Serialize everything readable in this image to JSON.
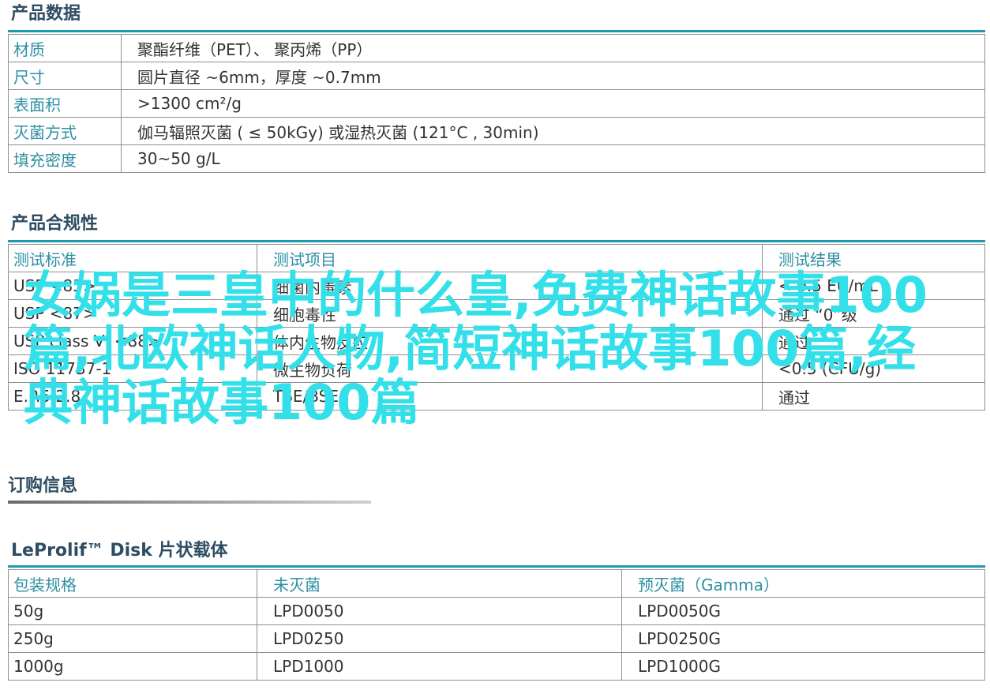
{
  "product_data": {
    "title": "产品数据",
    "rows": [
      {
        "key": "材质",
        "value": "聚酯纤维（PET）、 聚丙烯（PP）"
      },
      {
        "key": "尺寸",
        "value": "圆片直径 ~6mm，厚度 ~0.7mm"
      },
      {
        "key": "表面积",
        "value": ">1300 cm²/g"
      },
      {
        "key": "灭菌方式",
        "value": "伽马辐照灭菌 ( ≤ 50kGy) 或湿热灭菌 (121°C , 30min)"
      },
      {
        "key": "填充密度",
        "value": "30~50 g/L"
      }
    ]
  },
  "compliance": {
    "title": "产品合规性",
    "headers": [
      "测试标准",
      "测试项目",
      "测试结果"
    ],
    "rows": [
      [
        "USP <85>",
        "细菌内毒素",
        "< 0.5 EU/mL"
      ],
      [
        "USP <87>",
        "细胞毒性",
        "通过 “0”级"
      ],
      [
        "USP class VI <88>",
        "体内生物反应",
        "通过"
      ],
      [
        "ISO 11737-1",
        "微生物负荷",
        "<0.5 (CFU/g)"
      ],
      [
        "E.P.5.2.8",
        "TSE/BSE",
        "通过"
      ]
    ]
  },
  "order_info": {
    "title": "订购信息"
  },
  "disk_table": {
    "title": "LeProlif™ Disk 片状载体",
    "headers": [
      "包装规格",
      "未灭菌",
      "预灭菌（Gamma）"
    ],
    "rows": [
      [
        "50g",
        "LPD0050",
        "LPD0050G"
      ],
      [
        "250g",
        "LPD0250",
        "LPD0250G"
      ],
      [
        "1000g",
        "LPD1000",
        "LPD1000G"
      ]
    ]
  },
  "overlay": {
    "text": "女娲是三皇中的什么皇,免费神话故事100篇,北欧神话人物,简短神话故事100篇,经典神话故事100篇"
  },
  "colors": {
    "accent_bar": "#1b9ab0",
    "key_text": "#2f8fa3",
    "heading": "#2e4d63",
    "overlay_text": "#33e0ea"
  }
}
